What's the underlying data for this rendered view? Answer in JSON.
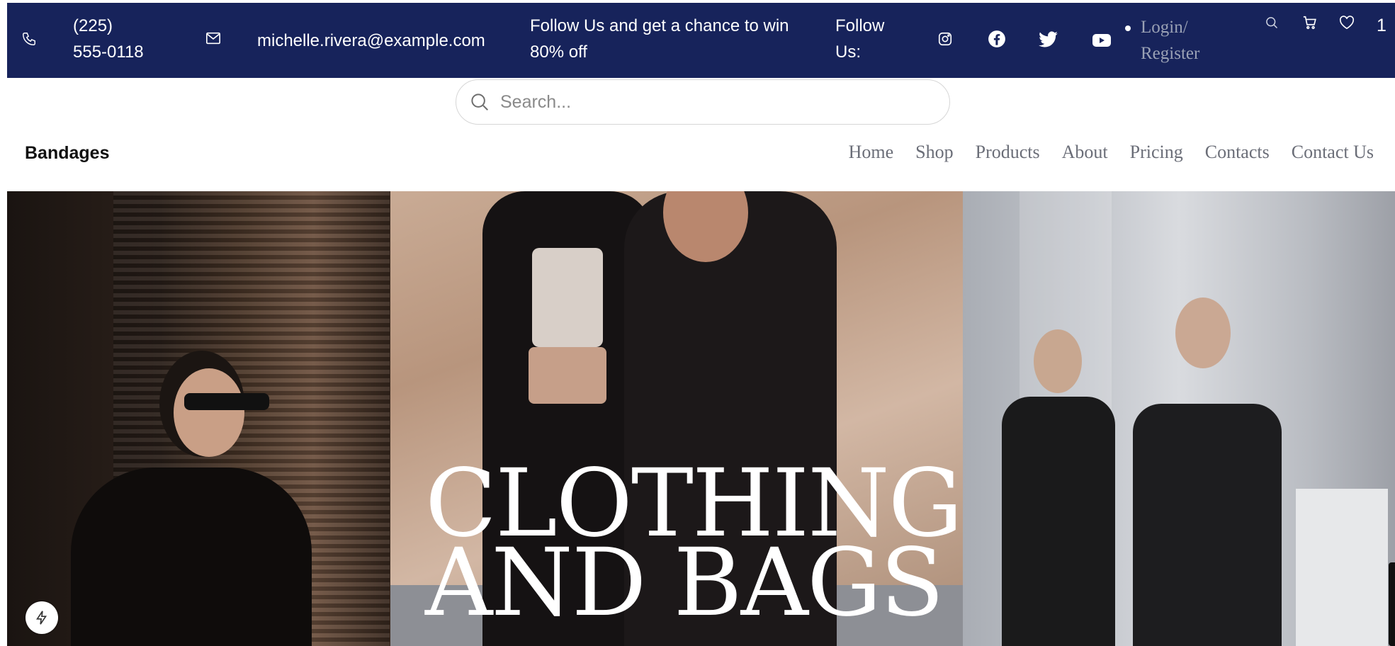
{
  "topbar": {
    "phone": "(225) 555-0118",
    "email": "michelle.rivera@example.com",
    "promo": "Follow Us and get a chance to win 80% off",
    "follow_label": "Follow Us:",
    "social_icons": [
      "instagram-icon",
      "facebook-icon",
      "twitter-icon",
      "youtube-icon"
    ],
    "login_label": "Login/ Register",
    "utility_icons": [
      "search-icon",
      "cart-icon",
      "heart-icon"
    ],
    "count": "1"
  },
  "search": {
    "placeholder": "Search..."
  },
  "header": {
    "brand": "Bandages",
    "nav": [
      "Home",
      "Shop",
      "Products",
      "About",
      "Pricing",
      "Contacts",
      "Contact Us"
    ]
  },
  "hero": {
    "title_line1": "CLOTHING",
    "title_line2": "AND BAGS"
  },
  "colors": {
    "topbar_bg": "#17235b",
    "nav_text": "#6b6e78",
    "brand_text": "#111111"
  }
}
